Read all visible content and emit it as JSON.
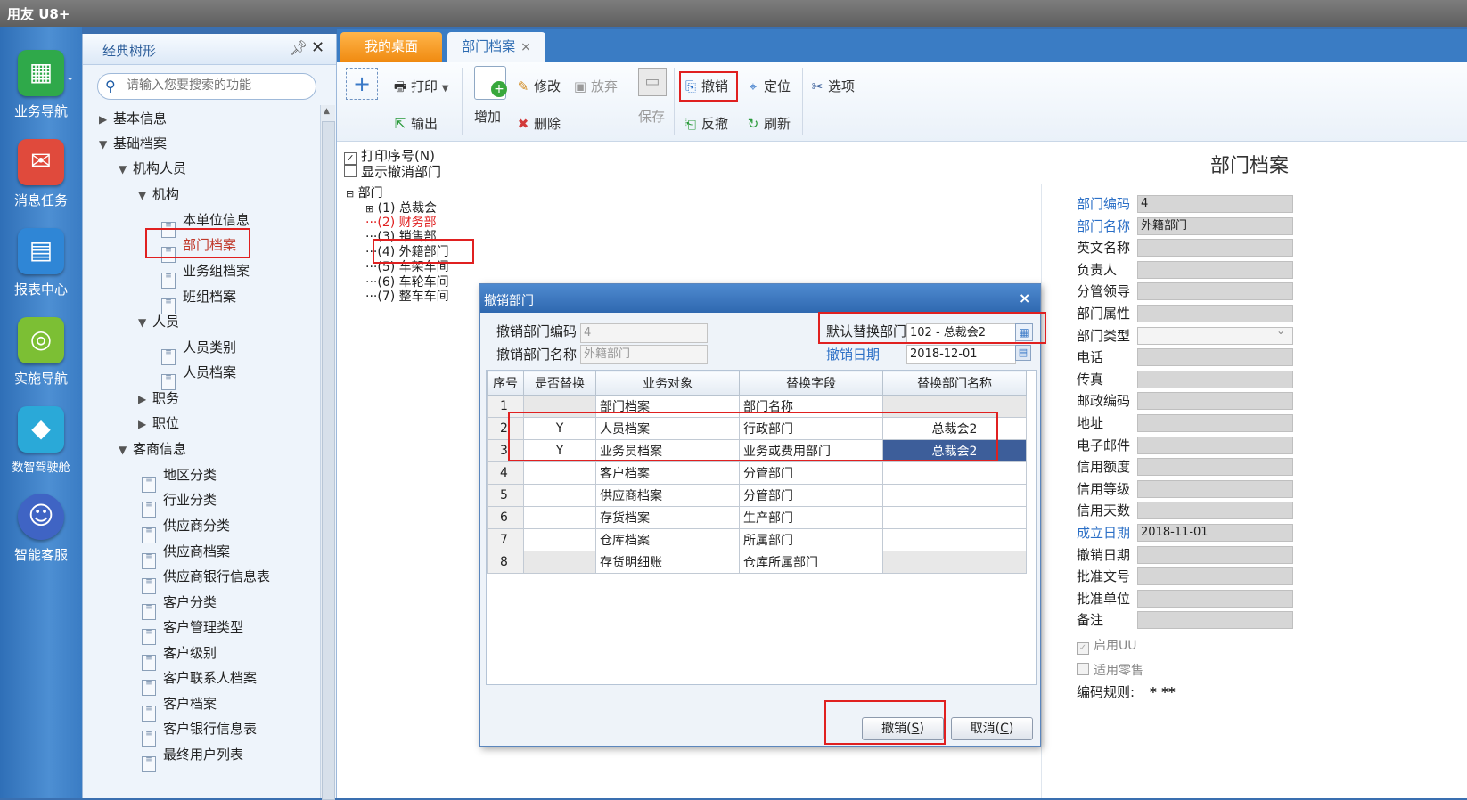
{
  "app": {
    "title": "用友 U8+"
  },
  "leftnav": [
    {
      "label": "业务导航",
      "icon": "org-chart-icon",
      "color": "#2fa94a"
    },
    {
      "label": "消息任务",
      "icon": "mail-icon",
      "color": "#e04a3c"
    },
    {
      "label": "报表中心",
      "icon": "report-icon",
      "color": "#2f86d6"
    },
    {
      "label": "实施导航",
      "icon": "compass-icon",
      "color": "#7cbf34"
    },
    {
      "label": "数智驾驶舱",
      "icon": "cube-icon",
      "color": "#2aa9d8"
    },
    {
      "label": "智能客服",
      "icon": "headset-icon",
      "color": "#3f64c4"
    }
  ],
  "tree": {
    "title": "经典树形",
    "search_placeholder": "请输入您要搜索的功能",
    "nodes": [
      {
        "label": "基本信息",
        "type": "collapsed"
      },
      {
        "label": "基础档案",
        "type": "expanded"
      },
      {
        "label": "机构人员",
        "type": "expanded"
      },
      {
        "label": "机构",
        "type": "expanded"
      },
      {
        "label": "本单位信息",
        "type": "doc"
      },
      {
        "label": "部门档案",
        "type": "doc"
      },
      {
        "label": "业务组档案",
        "type": "doc"
      },
      {
        "label": "班组档案",
        "type": "doc"
      },
      {
        "label": "人员",
        "type": "expanded"
      },
      {
        "label": "人员类别",
        "type": "doc"
      },
      {
        "label": "人员档案",
        "type": "doc"
      },
      {
        "label": "职务",
        "type": "collapsed"
      },
      {
        "label": "职位",
        "type": "collapsed"
      },
      {
        "label": "客商信息",
        "type": "expanded"
      },
      {
        "label": "地区分类",
        "type": "doc"
      },
      {
        "label": "行业分类",
        "type": "doc"
      },
      {
        "label": "供应商分类",
        "type": "doc"
      },
      {
        "label": "供应商档案",
        "type": "doc"
      },
      {
        "label": "供应商银行信息表",
        "type": "doc"
      },
      {
        "label": "客户分类",
        "type": "doc"
      },
      {
        "label": "客户管理类型",
        "type": "doc"
      },
      {
        "label": "客户级别",
        "type": "doc"
      },
      {
        "label": "客户联系人档案",
        "type": "doc"
      },
      {
        "label": "客户档案",
        "type": "doc"
      },
      {
        "label": "客户银行信息表",
        "type": "doc"
      },
      {
        "label": "最终用户列表",
        "type": "doc"
      }
    ]
  },
  "tabs": {
    "desktop": "我的桌面",
    "dept": "部门档案",
    "close": "×"
  },
  "toolbar": {
    "add": "+",
    "print": "打印",
    "export": "输出",
    "new": "增加",
    "edit": "修改",
    "abandon": "放弃",
    "delete": "删除",
    "save": "保存",
    "revoke": "撤销",
    "unrevoke": "反撤",
    "locate": "定位",
    "refresh": "刷新",
    "options": "选项"
  },
  "checks": {
    "print_seq": "打印序号(N)",
    "show_revoked": "显示撤消部门"
  },
  "dept_tree": {
    "root": "部门",
    "items": [
      {
        "label": "(1) 总裁会",
        "color": "#222222"
      },
      {
        "label": "(2) 财务部",
        "color": "#e02020"
      },
      {
        "label": "(3) 销售部",
        "color": "#222222"
      },
      {
        "label": "(4) 外籍部门",
        "color": "#222222"
      },
      {
        "label": "(5) 车架车间",
        "color": "#222222"
      },
      {
        "label": "(6) 车轮车间",
        "color": "#222222"
      },
      {
        "label": "(7) 整车车间",
        "color": "#222222"
      }
    ]
  },
  "form": {
    "title": "部门档案",
    "fields": [
      {
        "label": "部门编码",
        "value": "4",
        "req": true
      },
      {
        "label": "部门名称",
        "value": "外籍部门",
        "req": true
      },
      {
        "label": "英文名称",
        "value": "",
        "req": false
      },
      {
        "label": "负责人",
        "value": "",
        "req": false
      },
      {
        "label": "分管领导",
        "value": "",
        "req": false
      },
      {
        "label": "部门属性",
        "value": "",
        "req": false
      },
      {
        "label": "部门类型",
        "value": "",
        "req": false
      },
      {
        "label": "电话",
        "value": "",
        "req": false
      },
      {
        "label": "传真",
        "value": "",
        "req": false
      },
      {
        "label": "邮政编码",
        "value": "",
        "req": false
      },
      {
        "label": "地址",
        "value": "",
        "req": false
      },
      {
        "label": "电子邮件",
        "value": "",
        "req": false
      },
      {
        "label": "信用额度",
        "value": "",
        "req": false
      },
      {
        "label": "信用等级",
        "value": "",
        "req": false
      },
      {
        "label": "信用天数",
        "value": "",
        "req": false
      },
      {
        "label": "成立日期",
        "value": "2018-11-01",
        "req": true
      },
      {
        "label": "撤销日期",
        "value": "",
        "req": false
      },
      {
        "label": "批准文号",
        "value": "",
        "req": false
      },
      {
        "label": "批准单位",
        "value": "",
        "req": false
      },
      {
        "label": "备注",
        "value": "",
        "req": false
      }
    ],
    "enable_uu": "启用UU",
    "retail": "适用零售",
    "code_rule_label": "编码规则:",
    "code_rule_value": "* **"
  },
  "dialog": {
    "title": "撤销部门",
    "close": "×",
    "code_label": "撤销部门编码",
    "code_value": "4",
    "name_label": "撤销部门名称",
    "name_value": "外籍部门",
    "default_label": "默认替换部门",
    "default_value": "102 - 总裁会2",
    "date_label": "撤销日期",
    "date_value": "2018-12-01",
    "columns": [
      "序号",
      "是否替换",
      "业务对象",
      "替换字段",
      "替换部门名称"
    ],
    "rows": [
      {
        "seq": "1",
        "replace": "",
        "object": "部门档案",
        "field": "部门名称",
        "dept": ""
      },
      {
        "seq": "2",
        "replace": "Y",
        "object": "人员档案",
        "field": "行政部门",
        "dept": "总裁会2"
      },
      {
        "seq": "3",
        "replace": "Y",
        "object": "业务员档案",
        "field": "业务或费用部门",
        "dept": "总裁会2"
      },
      {
        "seq": "4",
        "replace": "",
        "object": "客户档案",
        "field": "分管部门",
        "dept": ""
      },
      {
        "seq": "5",
        "replace": "",
        "object": "供应商档案",
        "field": "分管部门",
        "dept": ""
      },
      {
        "seq": "6",
        "replace": "",
        "object": "存货档案",
        "field": "生产部门",
        "dept": ""
      },
      {
        "seq": "7",
        "replace": "",
        "object": "仓库档案",
        "field": "所属部门",
        "dept": ""
      },
      {
        "seq": "8",
        "replace": "",
        "object": "存货明细账",
        "field": "仓库所属部门",
        "dept": ""
      }
    ],
    "ok_label": "撤销(",
    "ok_key": "S",
    "cancel_label": "取消(",
    "cancel_key": "C",
    "paren_close": ")"
  }
}
